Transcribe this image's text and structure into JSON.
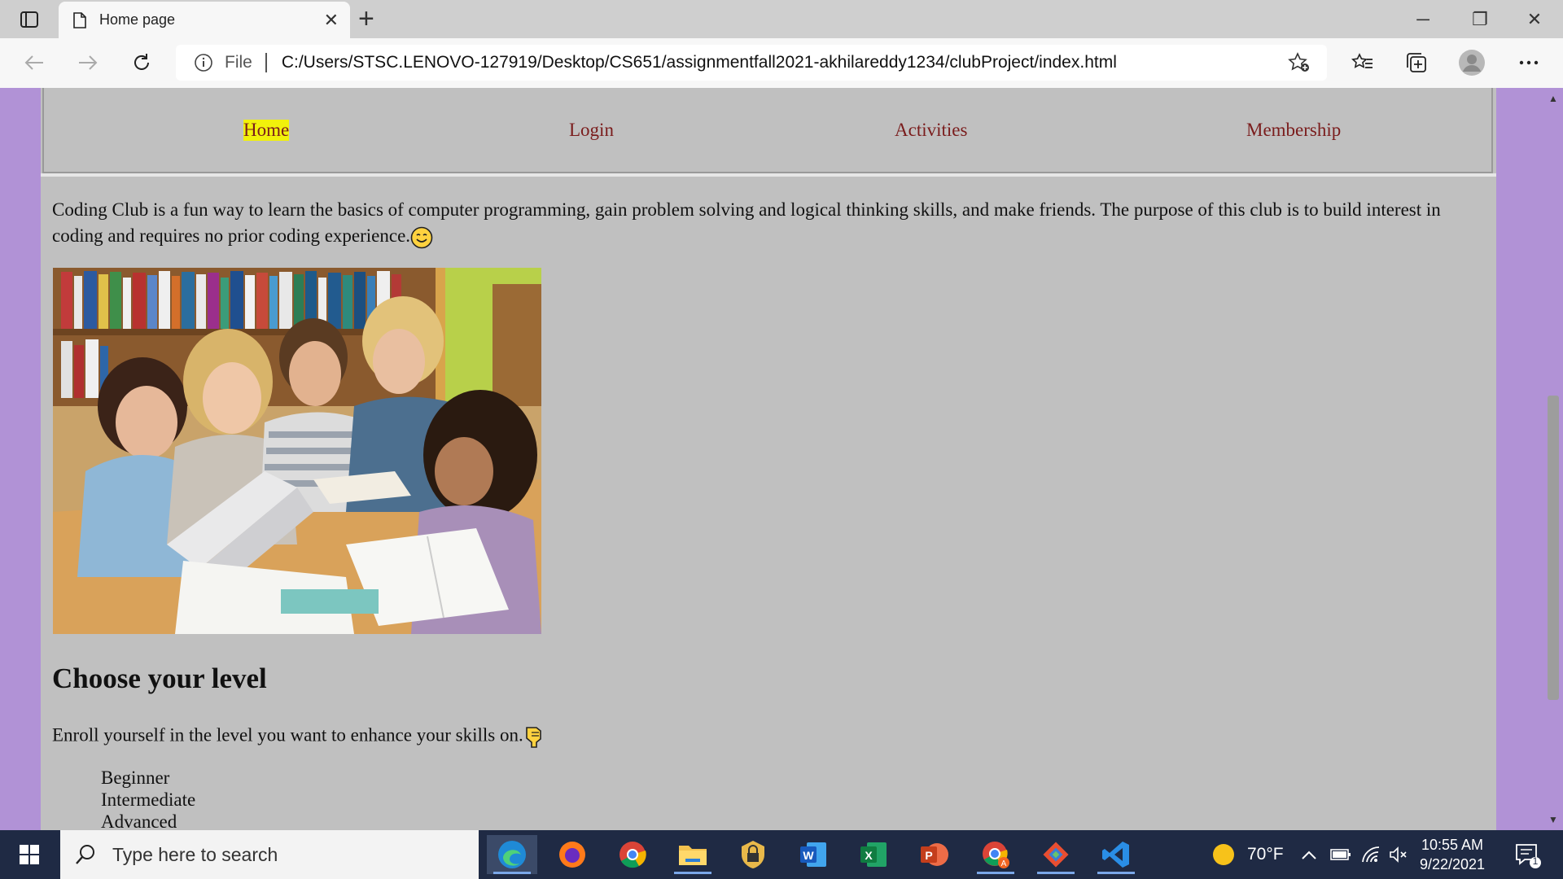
{
  "browser": {
    "tab_title": "Home page",
    "address_prefix": "File",
    "url": "C:/Users/STSC.LENOVO-127919/Desktop/CS651/assignmentfall2021-akhilareddy1234/clubProject/index.html"
  },
  "site": {
    "nav": [
      "Home",
      "Login",
      "Activities",
      "Membership"
    ],
    "active_nav": "Home",
    "intro_line1": "Coding Club is a fun way to learn the basics of computer programming, gain problem solving and logical thinking skills, and make friends. The purpose of this club is to build interest",
    "intro_line2": "in coding and requires no prior coding experience.",
    "heading": "Choose your level",
    "enroll_text": "Enroll yourself in the level you want to enhance your skills on.",
    "levels": [
      "Beginner",
      "Intermediate",
      "Advanced"
    ]
  },
  "taskbar": {
    "search_placeholder": "Type here to search",
    "weather": "70°F",
    "time": "10:55 AM",
    "date": "9/22/2021",
    "notification_count": "1"
  },
  "colors": {
    "page_background": "#b192d6",
    "content_background": "#c0c0c0",
    "nav_link": "#7a1c1c",
    "active_highlight": "#f1f10b"
  }
}
